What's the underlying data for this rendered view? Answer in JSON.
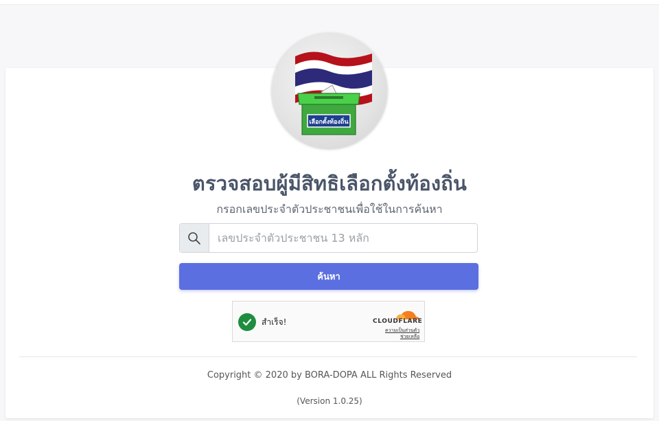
{
  "page": {
    "title": "ตรวจสอบผู้มีสิทธิเลือกตั้งท้องถิ่น",
    "subtitle": "กรอกเลขประจำตัวประชาชนเพื่อใช้ในการค้นหา"
  },
  "logo": {
    "ballot_label": "เลือกตั้งท้องถิ่น"
  },
  "search": {
    "placeholder": "เลขประจำตัวประชาชน 13 หลัก",
    "value": "",
    "button_label": "ค้นหา",
    "icon": "search-icon"
  },
  "captcha": {
    "status": "สำเร็จ!",
    "brand": "CLOUDFLARE",
    "privacy_link": "ความเป็นส่วนตัว",
    "help_link": "ช่วยเหลือ"
  },
  "footer": {
    "copyright": "Copyright © 2020 by BORA-DOPA ALL Rights Reserved",
    "version": "(Version 1.0.25)"
  },
  "colors": {
    "title_text": "#4a5568",
    "button_bg": "#5c6fe0",
    "success_green": "#1e8e3e",
    "cloudflare_orange": "#f38020"
  }
}
